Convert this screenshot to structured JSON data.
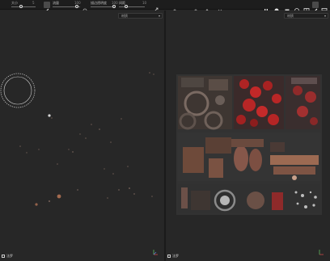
{
  "toolbar": {
    "size_label": "大小",
    "size_value": "5",
    "flow_label": "流量",
    "flow_value": "100",
    "stroke_opacity_label": "描边透明度",
    "stroke_opacity_value": "100",
    "spacing_label": "间距",
    "spacing_value": "10"
  },
  "viewport_left": {
    "mode": "材质",
    "footer": "法罗"
  },
  "viewport_right": {
    "mode": "材质",
    "footer": "法罗"
  },
  "colors": {
    "accent": "#e0e0e0",
    "background": "#272727",
    "toolbar": "#1d1d1d"
  }
}
